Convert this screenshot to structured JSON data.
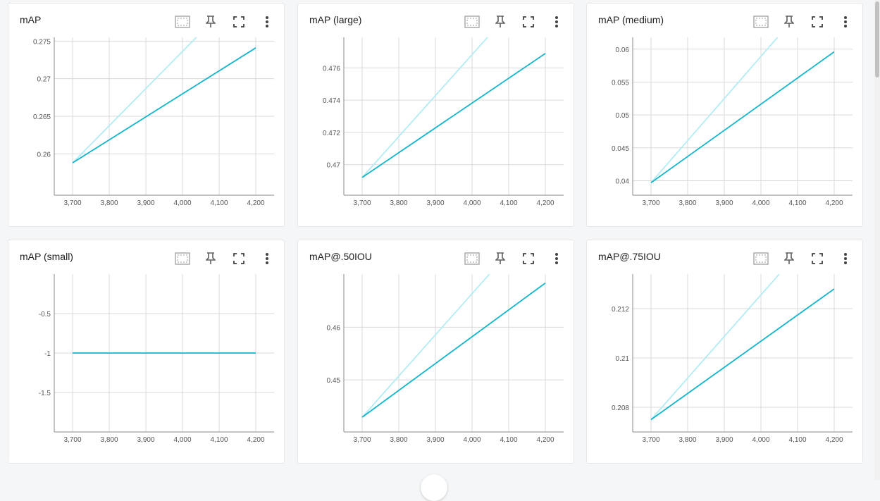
{
  "toolbar_icons": [
    "fit-domain-icon",
    "pin-icon",
    "fullscreen-icon",
    "more-vert-icon"
  ],
  "colors": {
    "series_main": "#12b5cb",
    "series_light": "#b3ecf5",
    "grid": "#d9d9d9",
    "axis": "#888888"
  },
  "cards": [
    {
      "title": "mAP",
      "chart_data": {
        "type": "line",
        "xticks": [
          "3,700",
          "3,800",
          "3,900",
          "4,000",
          "4,100",
          "4,200"
        ],
        "xlim": [
          3650,
          4250
        ],
        "ylim": [
          0.2545,
          0.2755
        ],
        "yticks": [
          "0.26",
          "0.265",
          "0.27",
          "0.275"
        ],
        "ytick_values": [
          0.26,
          0.265,
          0.27,
          0.275
        ],
        "series": [
          {
            "color": "#12b5cb",
            "x": [
              3700,
              4200
            ],
            "y": [
              0.2588,
              0.2741
            ]
          },
          {
            "color": "#b3ecf5",
            "x": [
              3700,
              4050
            ],
            "y": [
              0.2588,
              0.2761
            ]
          }
        ]
      }
    },
    {
      "title": "mAP (large)",
      "chart_data": {
        "type": "line",
        "xticks": [
          "3,700",
          "3,800",
          "3,900",
          "4,000",
          "4,100",
          "4,200"
        ],
        "xlim": [
          3650,
          4250
        ],
        "ylim": [
          0.4681,
          0.4779
        ],
        "yticks": [
          "0.47",
          "0.472",
          "0.474",
          "0.476"
        ],
        "ytick_values": [
          0.47,
          0.472,
          0.474,
          0.476
        ],
        "series": [
          {
            "color": "#12b5cb",
            "x": [
              3700,
              4200
            ],
            "y": [
              0.4692,
              0.4769
            ]
          },
          {
            "color": "#b3ecf5",
            "x": [
              3700,
              4050
            ],
            "y": [
              0.4692,
              0.4781
            ]
          }
        ]
      }
    },
    {
      "title": "mAP (medium)",
      "chart_data": {
        "type": "line",
        "xticks": [
          "3,700",
          "3,800",
          "3,900",
          "4,000",
          "4,100",
          "4,200"
        ],
        "xlim": [
          3650,
          4250
        ],
        "ylim": [
          0.0378,
          0.0618
        ],
        "yticks": [
          "0.04",
          "0.045",
          "0.05",
          "0.055",
          "0.06"
        ],
        "ytick_values": [
          0.04,
          0.045,
          0.05,
          0.055,
          0.06
        ],
        "series": [
          {
            "color": "#12b5cb",
            "x": [
              3700,
              4200
            ],
            "y": [
              0.0397,
              0.0596
            ]
          },
          {
            "color": "#b3ecf5",
            "x": [
              3700,
              4050
            ],
            "y": [
              0.0397,
              0.0621
            ]
          }
        ]
      }
    },
    {
      "title": "mAP (small)",
      "chart_data": {
        "type": "line",
        "xticks": [
          "3,700",
          "3,800",
          "3,900",
          "4,000",
          "4,100",
          "4,200"
        ],
        "xlim": [
          3650,
          4250
        ],
        "ylim": [
          -2,
          0
        ],
        "yticks": [
          "-0.5",
          "-1",
          "-1.5"
        ],
        "ytick_values": [
          -0.5,
          -1,
          -1.5
        ],
        "series": [
          {
            "color": "#12b5cb",
            "x": [
              3700,
              4200
            ],
            "y": [
              -1,
              -1
            ]
          }
        ]
      }
    },
    {
      "title": "mAP@.50IOU",
      "chart_data": {
        "type": "line",
        "xticks": [
          "3,700",
          "3,800",
          "3,900",
          "4,000",
          "4,100",
          "4,200"
        ],
        "xlim": [
          3650,
          4250
        ],
        "ylim": [
          0.4401,
          0.4701
        ],
        "yticks": [
          "0.45",
          "0.46"
        ],
        "ytick_values": [
          0.45,
          0.46
        ],
        "series": [
          {
            "color": "#12b5cb",
            "x": [
              3700,
              4200
            ],
            "y": [
              0.4429,
              0.4684
            ]
          },
          {
            "color": "#b3ecf5",
            "x": [
              3700,
              4050
            ],
            "y": [
              0.4429,
              0.4703
            ]
          }
        ]
      }
    },
    {
      "title": "mAP@.75IOU",
      "chart_data": {
        "type": "line",
        "xticks": [
          "3,700",
          "3,800",
          "3,900",
          "4,000",
          "4,100",
          "4,200"
        ],
        "xlim": [
          3650,
          4250
        ],
        "ylim": [
          0.207,
          0.2134
        ],
        "yticks": [
          "0.208",
          "0.21",
          "0.212"
        ],
        "ytick_values": [
          0.208,
          0.21,
          0.212
        ],
        "series": [
          {
            "color": "#12b5cb",
            "x": [
              3700,
              4200
            ],
            "y": [
              0.2075,
              0.2128
            ]
          },
          {
            "color": "#b3ecf5",
            "x": [
              3700,
              4050
            ],
            "y": [
              0.2075,
              0.2134
            ]
          }
        ]
      }
    }
  ]
}
